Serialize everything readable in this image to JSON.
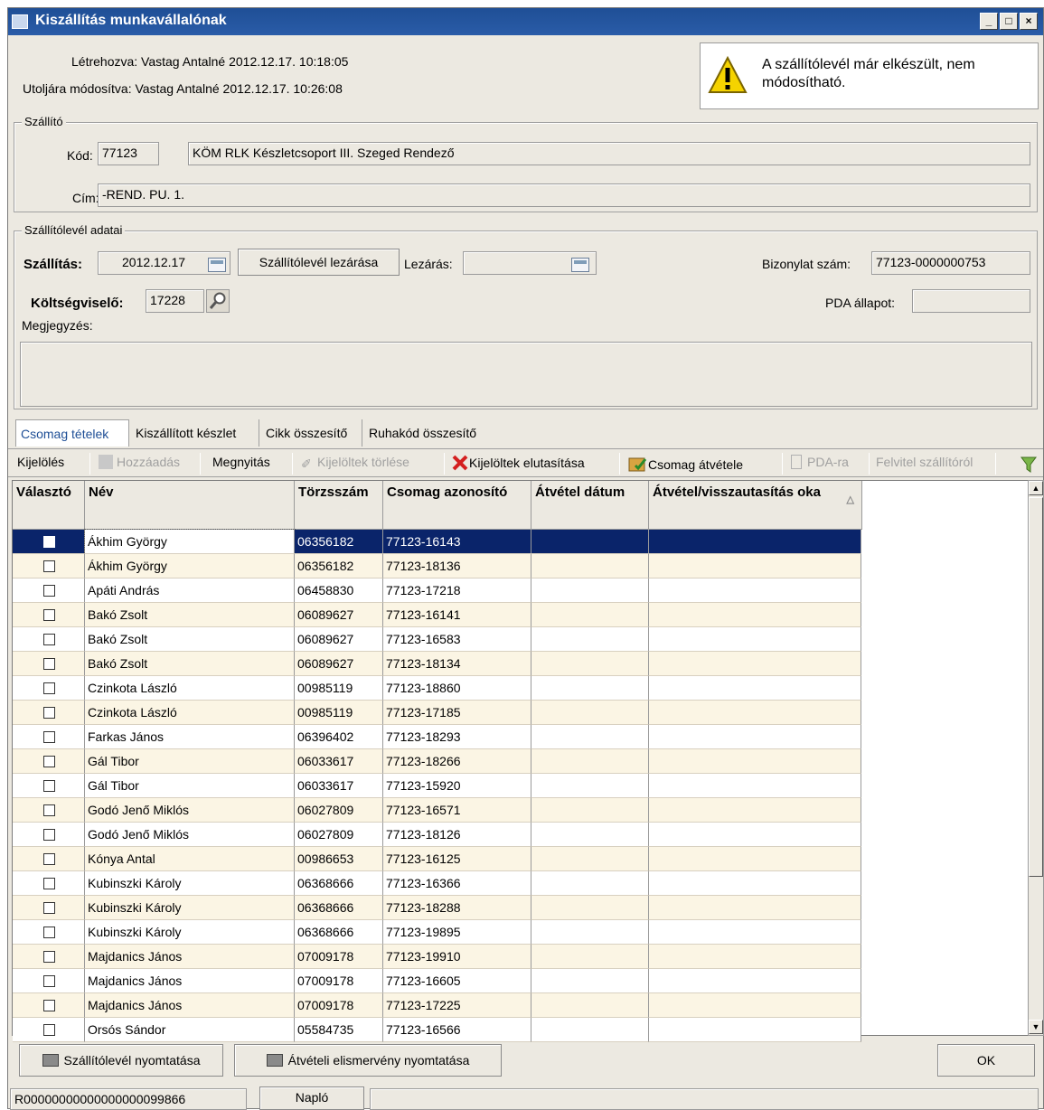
{
  "window": {
    "title": "Kiszállítás munkavállalónak",
    "minimize": "_",
    "maximize": "□",
    "close": "×"
  },
  "info": {
    "created": "Létrehozva: Vastag Antalné 2012.12.17. 10:18:05",
    "modified": "Utoljára módosítva: Vastag Antalné 2012.12.17. 10:26:08",
    "warning": "A szállítólevél már elkészült, nem módosítható."
  },
  "supplier": {
    "group_label": "Szállító",
    "code_label": "Kód:",
    "code_value": "77123",
    "name_value": "KÖM RLK Készletcsoport III. Szeged Rendező",
    "address_label": "Cím:",
    "address_value": "-REND. PU. 1."
  },
  "delivery": {
    "group_label": "Szállítólevél adatai",
    "shipping_label": "Szállítás:",
    "shipping_date": "2012.12.17",
    "close_button": "Szállítólevél lezárása",
    "closing_label": "Lezárás:",
    "closing_value": "",
    "doc_number_label": "Bizonylat szám:",
    "doc_number_value": "77123-0000000753",
    "cost_bearer_label": "Költségviselő:",
    "cost_bearer_value": "17228",
    "pda_label": "PDA állapot:",
    "pda_value": "",
    "note_label": "Megjegyzés:",
    "note_value": ""
  },
  "tabs": [
    {
      "label": "Csomag tételek"
    },
    {
      "label": "Kiszállított készlet"
    },
    {
      "label": "Cikk összesítő"
    },
    {
      "label": "Ruhakód összesítő"
    }
  ],
  "toolbar": {
    "select": "Kijelölés",
    "add": "Hozzáadás",
    "open": "Megnyitás",
    "delete_selected": "Kijelöltek törlése",
    "reject_selected": "Kijelöltek elutasítása",
    "receive_package": "Csomag átvétele",
    "to_pda": "PDA-ra",
    "from_supplier": "Felvitel szállítóról"
  },
  "table": {
    "headers": {
      "select": "Választó",
      "name": "Név",
      "id": "Törzsszám",
      "package": "Csomag azonosító",
      "date": "Átvétel dátum",
      "reason": "Átvétel/visszautasítás oka"
    },
    "rows": [
      {
        "name": "Ákhim György",
        "id": "06356182",
        "package": "77123-16143",
        "date": "",
        "reason": "",
        "checked": true,
        "selected": true
      },
      {
        "name": "Ákhim György",
        "id": "06356182",
        "package": "77123-18136",
        "date": "",
        "reason": ""
      },
      {
        "name": "Apáti András",
        "id": "06458830",
        "package": "77123-17218",
        "date": "",
        "reason": ""
      },
      {
        "name": "Bakó Zsolt",
        "id": "06089627",
        "package": "77123-16141",
        "date": "",
        "reason": ""
      },
      {
        "name": "Bakó Zsolt",
        "id": "06089627",
        "package": "77123-16583",
        "date": "",
        "reason": ""
      },
      {
        "name": "Bakó Zsolt",
        "id": "06089627",
        "package": "77123-18134",
        "date": "",
        "reason": ""
      },
      {
        "name": "Czinkota László",
        "id": "00985119",
        "package": "77123-18860",
        "date": "",
        "reason": ""
      },
      {
        "name": "Czinkota László",
        "id": "00985119",
        "package": "77123-17185",
        "date": "",
        "reason": ""
      },
      {
        "name": "Farkas János",
        "id": "06396402",
        "package": "77123-18293",
        "date": "",
        "reason": ""
      },
      {
        "name": "Gál Tibor",
        "id": "06033617",
        "package": "77123-18266",
        "date": "",
        "reason": ""
      },
      {
        "name": "Gál Tibor",
        "id": "06033617",
        "package": "77123-15920",
        "date": "",
        "reason": ""
      },
      {
        "name": "Godó Jenő Miklós",
        "id": "06027809",
        "package": "77123-16571",
        "date": "",
        "reason": ""
      },
      {
        "name": "Godó Jenő Miklós",
        "id": "06027809",
        "package": "77123-18126",
        "date": "",
        "reason": ""
      },
      {
        "name": "Kónya Antal",
        "id": "00986653",
        "package": "77123-16125",
        "date": "",
        "reason": ""
      },
      {
        "name": "Kubinszki Károly",
        "id": "06368666",
        "package": "77123-16366",
        "date": "",
        "reason": ""
      },
      {
        "name": "Kubinszki Károly",
        "id": "06368666",
        "package": "77123-18288",
        "date": "",
        "reason": ""
      },
      {
        "name": "Kubinszki Károly",
        "id": "06368666",
        "package": "77123-19895",
        "date": "",
        "reason": ""
      },
      {
        "name": "Majdanics János",
        "id": "07009178",
        "package": "77123-19910",
        "date": "",
        "reason": ""
      },
      {
        "name": "Majdanics János",
        "id": "07009178",
        "package": "77123-16605",
        "date": "",
        "reason": ""
      },
      {
        "name": "Majdanics János",
        "id": "07009178",
        "package": "77123-17225",
        "date": "",
        "reason": ""
      },
      {
        "name": "Orsós Sándor",
        "id": "05584735",
        "package": "77123-16566",
        "date": "",
        "reason": ""
      }
    ]
  },
  "footer": {
    "print_delivery": "Szállítólevél nyomtatása",
    "print_receipt": "Átvételi elismervény nyomtatása",
    "ok": "OK"
  },
  "statusbar": {
    "record_id": "R00000000000000000099866",
    "log_button": "Napló"
  },
  "colors": {
    "titlebar": "#1f4f96",
    "selected_row": "#0a246a",
    "stripe": "#fbf5e4",
    "window_bg": "#ece9e1"
  }
}
